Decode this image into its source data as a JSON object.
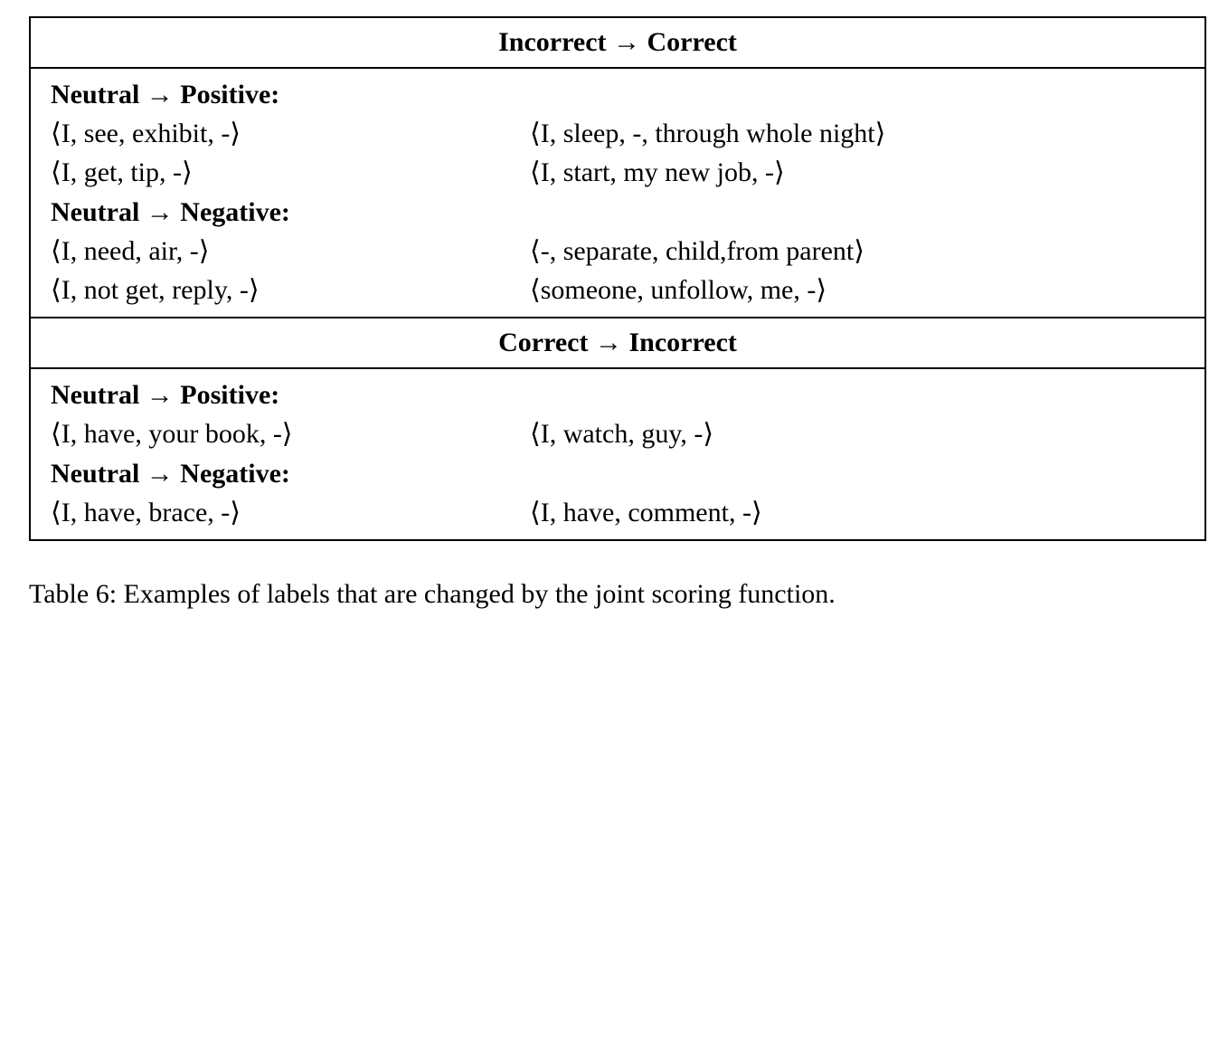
{
  "headers": {
    "inc_to_cor": "Incorrect → Correct",
    "cor_to_inc": "Correct → Incorrect"
  },
  "section1": {
    "sub_pos": "Neutral → Positive:",
    "pos_rows": [
      {
        "left": "⟨I, see, exhibit, -⟩",
        "right": "⟨I, sleep, -, through whole night⟩"
      },
      {
        "left": "⟨I, get, tip, -⟩",
        "right": "⟨I, start, my new job, -⟩"
      }
    ],
    "sub_neg": "Neutral → Negative:",
    "neg_rows": [
      {
        "left": "⟨I, need, air, -⟩",
        "right": "⟨-, separate, child,from parent⟩"
      },
      {
        "left": "⟨I, not get, reply, -⟩",
        "right": "⟨someone, unfollow, me, -⟩"
      }
    ]
  },
  "section2": {
    "sub_pos": "Neutral → Positive:",
    "pos_rows": [
      {
        "left": "⟨I, have, your book, -⟩",
        "right": "⟨I, watch, guy, -⟩"
      }
    ],
    "sub_neg": "Neutral → Negative:",
    "neg_rows": [
      {
        "left": "⟨I, have, brace, -⟩",
        "right": "⟨I, have, comment, -⟩"
      }
    ]
  },
  "caption": "Table 6: Examples of labels that are changed by the joint scoring function."
}
